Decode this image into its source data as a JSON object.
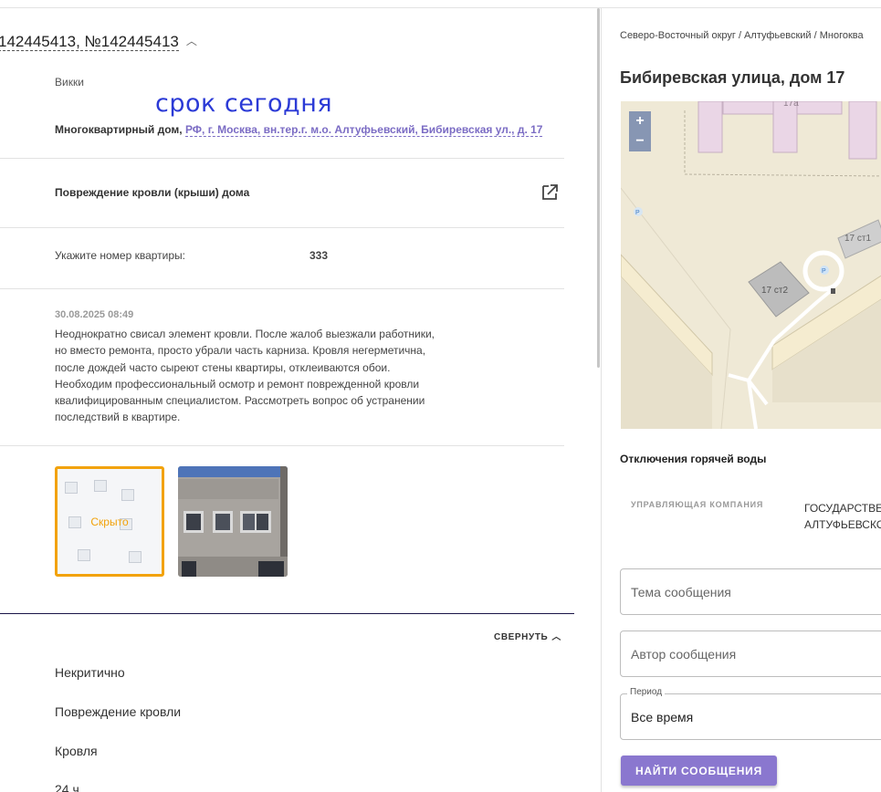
{
  "request": {
    "title": "142445413, №142445413",
    "author": "Викки",
    "stamp": "срок сегодня",
    "building_type": "Многоквартирный дом,",
    "address_link": "РФ, г. Москва, вн.тер.г. м.о. Алтуфьевский, Бибиревская ул., д. 17",
    "category": "Повреждение кровли (крыши) дома",
    "apartment_label": "Укажите номер квартиры:",
    "apartment_value": "333",
    "date": "30.08.2025 08:49",
    "description": "Неоднократно свисал элемент кровли. После жалоб выезжали работники, но вместо ремонта, просто убрали часть карниза. Кровля негерметична, после дождей часто сыреют стены квартиры, отклеиваются обои. Необходим профессиональный осмотр и ремонт поврежденной кровли квалифицированным специалистом. Рассмотреть вопрос об устранении последствий в квартире.",
    "hidden_photo_label": "Скрыто",
    "collapse_label": "СВЕРНУТЬ",
    "properties": [
      "Некритично",
      "Повреждение кровли",
      "Кровля",
      "24 ч"
    ]
  },
  "sidebar": {
    "breadcrumbs": "Северо-Восточный округ / Алтуфьевский / Многоква",
    "street": "Бибиревская улица, дом 17",
    "map": {
      "zoom_in": "+",
      "zoom_out": "−",
      "labels": [
        "17а",
        "17 ст1",
        "17 ст2"
      ],
      "parking": "P"
    },
    "hot_water_title": "Отключения горячей воды",
    "management_label": "УПРАВЛЯЮЩАЯ КОМПАНИЯ",
    "management_value_line1": "ГОСУДАРСТВЕ",
    "management_value_line2": "АЛТУФЬЕВСКО",
    "subject_placeholder": "Тема сообщения",
    "author_placeholder": "Автор сообщения",
    "period_label": "Период",
    "period_value": "Все время",
    "find_button": "НАЙТИ СООБЩЕНИЯ"
  },
  "colors": {
    "accent": "#8a77cf",
    "link": "#7b6cc4",
    "stamp": "#2b3ad6",
    "hidden_border": "#f2a20a"
  }
}
